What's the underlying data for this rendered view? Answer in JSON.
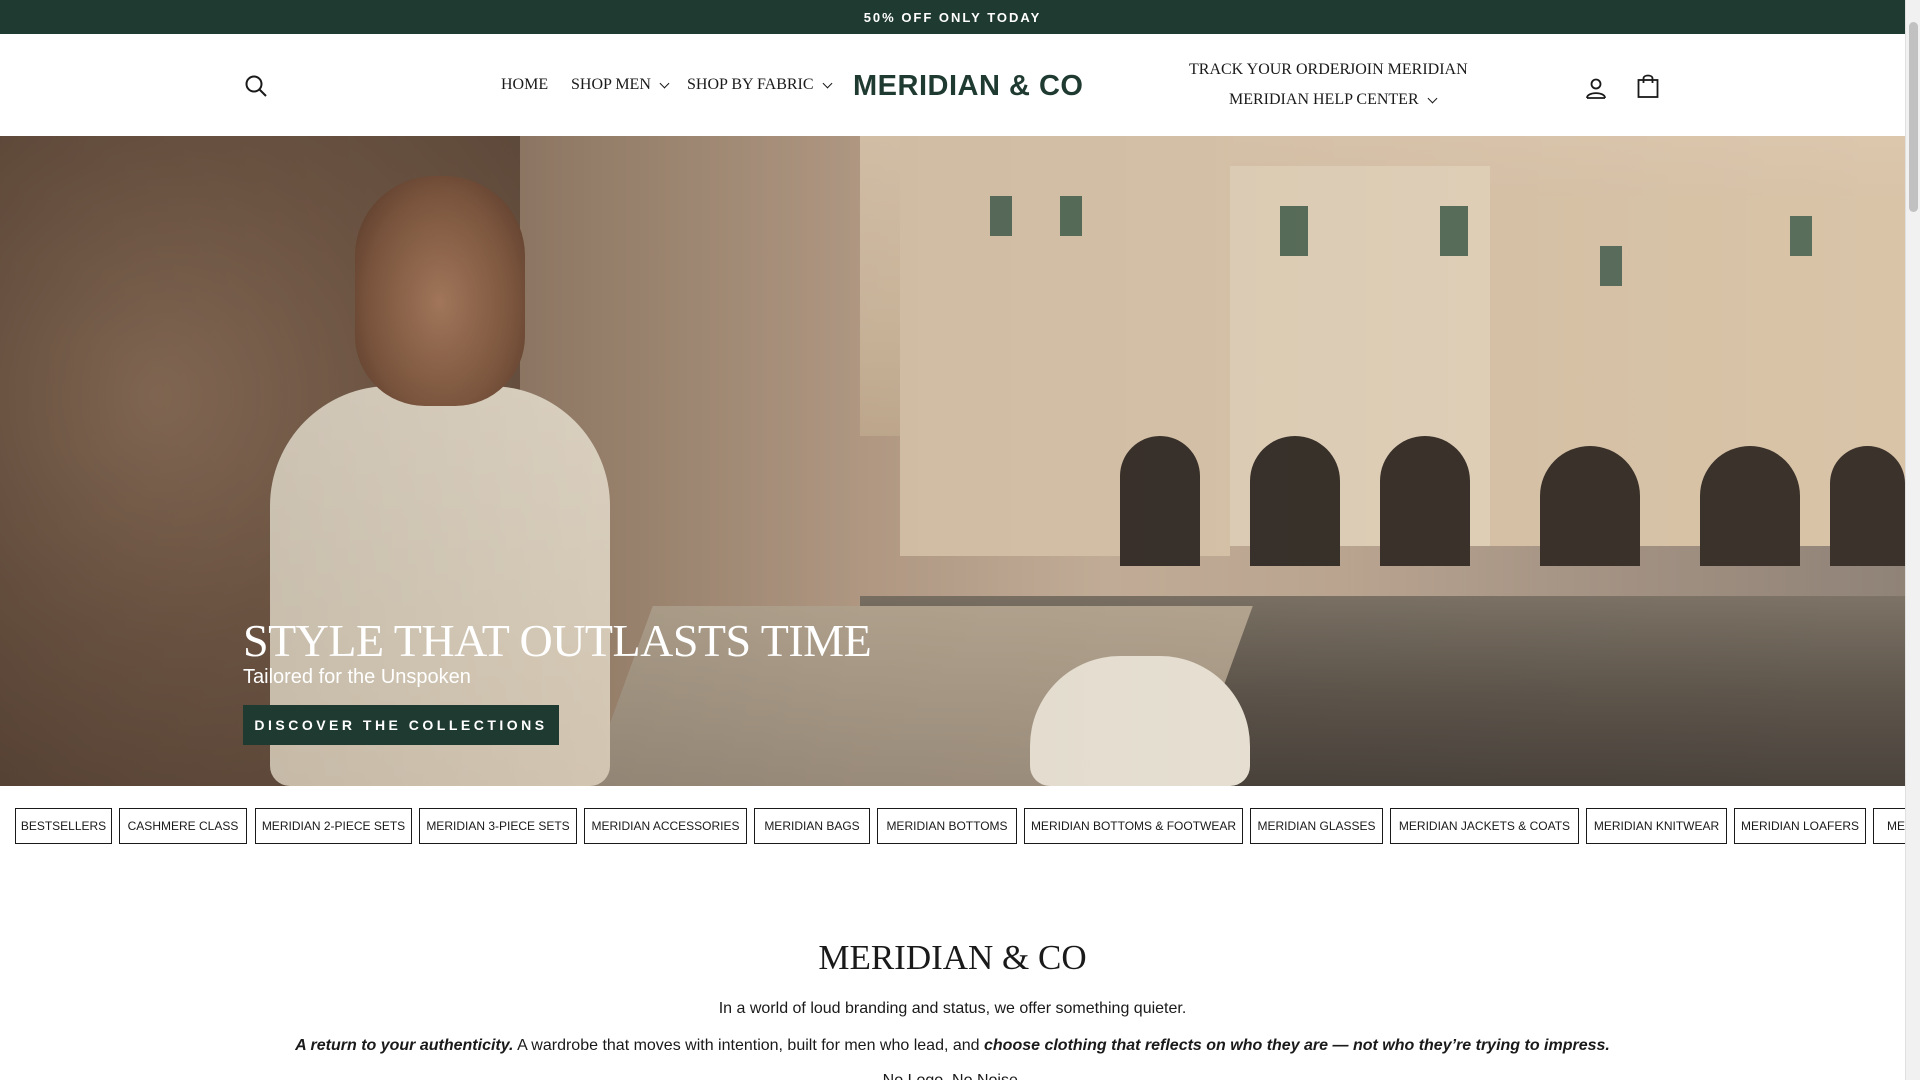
{
  "announcement": {
    "text": "50% OFF ONLY TODAY"
  },
  "header": {
    "logo": "MERIDIAN & CO",
    "nav_left": [
      {
        "label": "HOME",
        "has_dropdown": false
      },
      {
        "label": "SHOP MEN",
        "has_dropdown": true
      },
      {
        "label": "SHOP BY FABRIC",
        "has_dropdown": true
      }
    ],
    "nav_right": [
      {
        "label": "TRACK YOUR ORDER",
        "has_dropdown": false
      },
      {
        "label": "JOIN MERIDIAN",
        "has_dropdown": false
      },
      {
        "label": "MERIDIAN HELP CENTER",
        "has_dropdown": true
      }
    ],
    "icons": {
      "search": "search-icon",
      "account": "user-icon",
      "cart": "shopping-bag-icon"
    }
  },
  "hero": {
    "title": "STYLE THAT OUTLASTS TIME",
    "subtitle": "Tailored for the Unspoken",
    "cta_label": "DISCOVER THE COLLECTIONS"
  },
  "collections": [
    "BESTSELLERS",
    "CASHMERE CLASS",
    "MERIDIAN 2-PIECE SETS",
    "MERIDIAN 3-PIECE SETS",
    "MERIDIAN ACCESSORIES",
    "MERIDIAN BAGS",
    "MERIDIAN BOTTOMS",
    "MERIDIAN BOTTOMS & FOOTWEAR",
    "MERIDIAN GLASSES",
    "MERIDIAN JACKETS & COATS",
    "MERIDIAN KNITWEAR",
    "MERIDIAN LOAFERS",
    "MERIDIAN"
  ],
  "intro": {
    "title": "MERIDIAN & CO",
    "line1": "In a world of loud branding and status, we offer something quieter.",
    "line2_bold_a": "A return to your authenticity.",
    "line2_plain": " A wardrobe that moves with intention, built for men who lead, and ",
    "line2_bold_b": "choose clothing that reflects on who they are — not who they’re trying to impress.",
    "line3": "No Logo. No Noise."
  },
  "colors": {
    "brand_green": "#1f3a30",
    "text": "#1a1a1a",
    "background": "#ffffff"
  }
}
